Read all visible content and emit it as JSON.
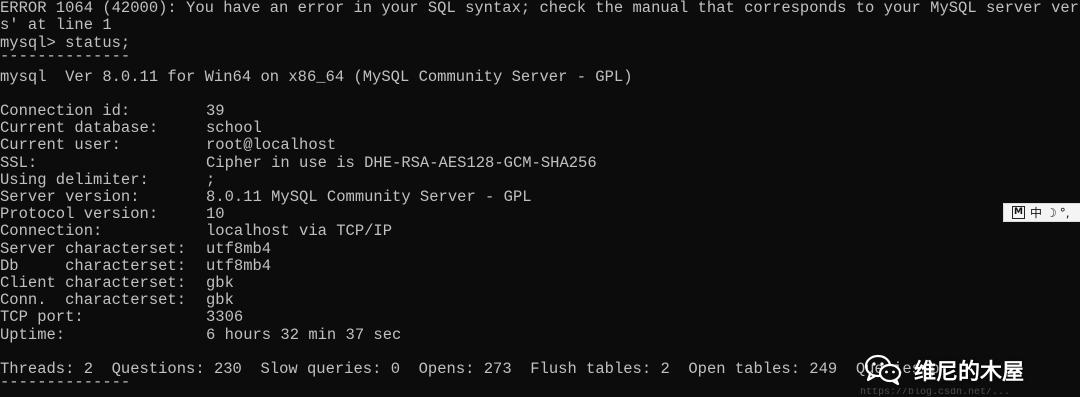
{
  "terminal": {
    "error_line1": "ERROR 1064 (42000): You have an error in your SQL syntax; check the manual that corresponds to your MySQL server version for t",
    "error_line2": "s' at line 1",
    "prompt": "mysql> status;",
    "separator": "--------------",
    "version_line": "mysql  Ver 8.0.11 for Win64 on x86_64 (MySQL Community Server - GPL)",
    "status_rows": [
      {
        "key": "Connection id:",
        "value": "39"
      },
      {
        "key": "Current database:",
        "value": "school"
      },
      {
        "key": "Current user:",
        "value": "root@localhost"
      },
      {
        "key": "SSL:",
        "value": "Cipher in use is DHE-RSA-AES128-GCM-SHA256"
      },
      {
        "key": "Using delimiter:",
        "value": ";"
      },
      {
        "key": "Server version:",
        "value": "8.0.11 MySQL Community Server - GPL"
      },
      {
        "key": "Protocol version:",
        "value": "10"
      },
      {
        "key": "Connection:",
        "value": "localhost via TCP/IP"
      },
      {
        "key": "Server characterset:",
        "value": "utf8mb4"
      },
      {
        "key": "Db     characterset:",
        "value": "utf8mb4"
      },
      {
        "key": "Client characterset:",
        "value": "gbk"
      },
      {
        "key": "Conn.  characterset:",
        "value": "gbk"
      },
      {
        "key": "TCP port:",
        "value": "3306"
      },
      {
        "key": "Uptime:",
        "value": "6 hours 32 min 37 sec"
      }
    ],
    "stats": {
      "threads": "Threads: 2",
      "questions": "Questions: 230",
      "slow_queries": "Slow queries: 0",
      "opens": "Opens: 273",
      "flush_tables": "Flush tables: 2",
      "open_tables": "Open tables: 249",
      "queries_fragment": "Queries p"
    },
    "bottom_separator": "--------------",
    "blurred_tail": "https://blog.csdn.net/..."
  },
  "ime": {
    "mode": "M",
    "language": "中",
    "shape": "☽",
    "punctuation": "°,"
  },
  "watermark": {
    "icon": "wechat-icon",
    "text": "维尼的木屋"
  },
  "colors": {
    "background": "#0c0c0c",
    "text": "#c0c0c0"
  }
}
